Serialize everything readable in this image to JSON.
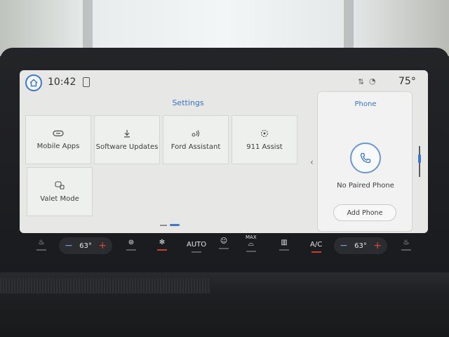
{
  "status": {
    "time": "10:42",
    "outside_temp": "75°"
  },
  "settings": {
    "title": "Settings",
    "tiles": [
      {
        "label": "Mobile Apps",
        "icon": "link-icon"
      },
      {
        "label": "Software Updates",
        "icon": "download-icon"
      },
      {
        "label": "Ford Assistant",
        "icon": "voice-icon"
      },
      {
        "label": "911 Assist",
        "icon": "emergency-icon"
      },
      {
        "label": "Valet Mode",
        "icon": "valet-lock-icon"
      }
    ]
  },
  "phone": {
    "title": "Phone",
    "status": "No Paired Phone",
    "add_label": "Add Phone"
  },
  "climate": {
    "driver_temp": "63°",
    "passenger_temp": "63°",
    "auto_label": "AUTO",
    "max_label": "MAX",
    "ac_label": "A/C",
    "minus": "−",
    "plus": "+"
  },
  "colors": {
    "accent": "#3f78c8",
    "heat": "#d8453a"
  }
}
